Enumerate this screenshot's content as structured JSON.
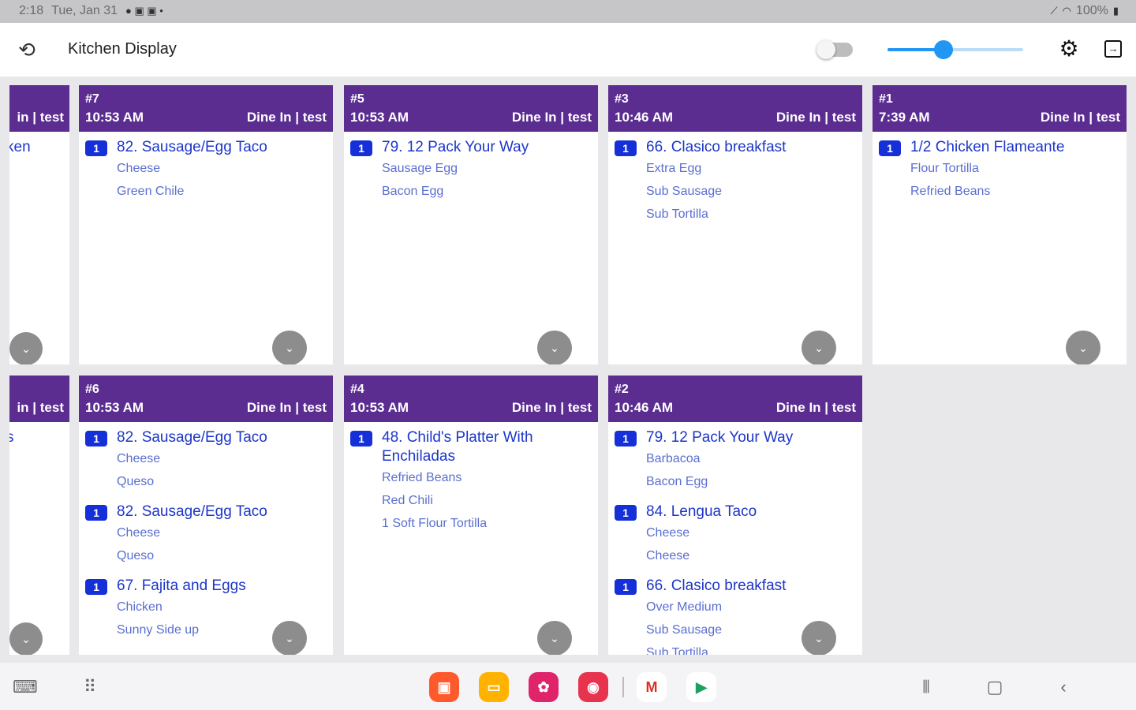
{
  "status_bar": {
    "time": "2:18",
    "date": "Tue, Jan 31",
    "battery": "100%"
  },
  "app_bar": {
    "title": "Kitchen Display",
    "toggle_on": false,
    "slider_value": 0.41
  },
  "partial_cards": [
    {
      "order_type": "in | test",
      "text": "ken"
    },
    {
      "order_type": "in | test",
      "text": "s"
    }
  ],
  "cards": [
    {
      "number": "#7",
      "time": "10:53 AM",
      "order_type": "Dine In | test",
      "items": [
        {
          "qty": "1",
          "name": "82.  Sausage/Egg Taco",
          "mods": [
            "Cheese",
            "Green Chile"
          ]
        }
      ]
    },
    {
      "number": "#5",
      "time": "10:53 AM",
      "order_type": "Dine In | test",
      "items": [
        {
          "qty": "1",
          "name": "79. 12 Pack Your Way",
          "mods": [
            "Sausage Egg",
            "Bacon Egg"
          ]
        }
      ]
    },
    {
      "number": "#3",
      "time": "10:46 AM",
      "order_type": "Dine In | test",
      "items": [
        {
          "qty": "1",
          "name": "66. Clasico breakfast",
          "mods": [
            "Extra Egg",
            "Sub Sausage",
            "Sub Tortilla"
          ]
        }
      ]
    },
    {
      "number": "#1",
      "time": "7:39 AM",
      "order_type": "Dine In | test",
      "items": [
        {
          "qty": "1",
          "name": "1/2 Chicken Flameante",
          "mods": [
            "Flour Tortilla",
            "Refried Beans"
          ]
        }
      ]
    },
    {
      "number": "#6",
      "time": "10:53 AM",
      "order_type": "Dine In | test",
      "items": [
        {
          "qty": "1",
          "name": "82.  Sausage/Egg Taco",
          "mods": [
            "Cheese",
            "Queso"
          ]
        },
        {
          "qty": "1",
          "name": "82.  Sausage/Egg Taco",
          "mods": [
            "Cheese",
            "Queso"
          ]
        },
        {
          "qty": "1",
          "name": "67. Fajita and Eggs",
          "mods": [
            "Chicken",
            "Sunny Side up"
          ]
        }
      ]
    },
    {
      "number": "#4",
      "time": "10:53 AM",
      "order_type": "Dine In | test",
      "items": [
        {
          "qty": "1",
          "name": "48. Child's Platter With Enchiladas",
          "mods": [
            "Refried Beans",
            "Red Chili",
            "1 Soft Flour Tortilla"
          ]
        }
      ]
    },
    {
      "number": "#2",
      "time": "10:46 AM",
      "order_type": "Dine In | test",
      "items": [
        {
          "qty": "1",
          "name": "79. 12 Pack Your Way",
          "mods": [
            "Barbacoa",
            "Bacon Egg"
          ]
        },
        {
          "qty": "1",
          "name": "84. Lengua Taco",
          "mods": [
            "Cheese",
            "Cheese"
          ]
        },
        {
          "qty": "1",
          "name": "66. Clasico breakfast",
          "mods": [
            "Over Medium",
            "Sub Sausage",
            "Sub Tortilla"
          ]
        }
      ]
    }
  ],
  "colors": {
    "header_purple": "#5c2d91",
    "item_blue": "#1d36c9",
    "modifier_blue": "#5a6fd0",
    "qty_badge": "#1530d8",
    "accent_slider": "#2196f3"
  },
  "icons": {
    "refresh": "refresh-icon",
    "settings": "gear-icon",
    "exit": "exit-icon",
    "expand": "chevron-down-icon"
  }
}
